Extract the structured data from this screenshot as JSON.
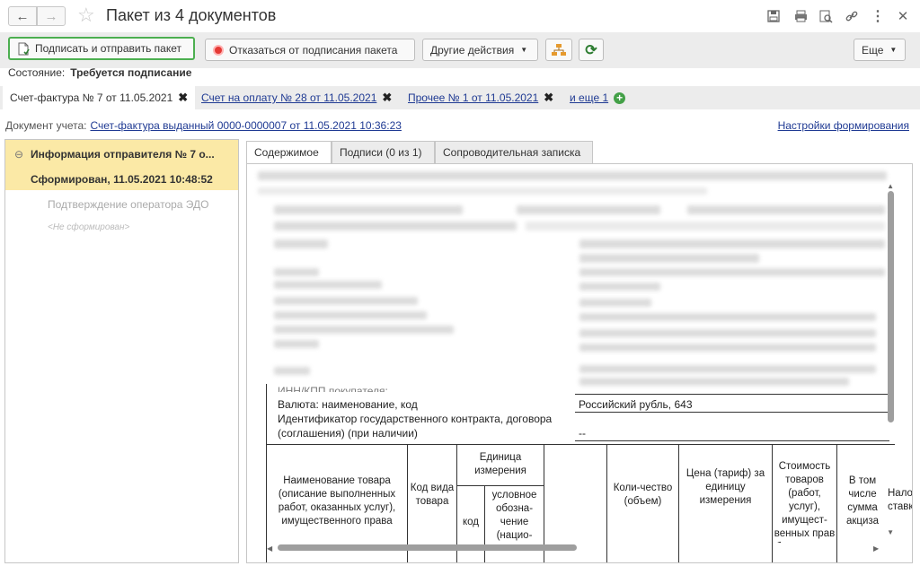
{
  "window": {
    "title": "Пакет из 4 документов",
    "back_icon": "arrow-left-icon",
    "forward_icon": "arrow-right-icon",
    "favorite_icon": "star-icon",
    "more_icon": "⋮"
  },
  "toolbar": {
    "sign_send": "Подписать и отправить пакет",
    "decline": "Отказаться от подписания пакета",
    "other_actions": "Другие действия",
    "more": "Еще"
  },
  "status": {
    "label": "Состояние:",
    "value": "Требуется подписание"
  },
  "doc_tabs": [
    {
      "label": "Счет-фактура № 7 от 11.05.2021"
    },
    {
      "label": "Счет на оплату № 28 от 11.05.2021"
    },
    {
      "label": "Прочее № 1 от 11.05.2021"
    },
    {
      "label": "и еще 1"
    }
  ],
  "account_doc": {
    "label": "Документ учета:",
    "link": "Счет-фактура выданный 0000-0000007 от 11.05.2021 10:36:23"
  },
  "settings_link": "Настройки формирования",
  "tree": {
    "item1_title": "Информация отправителя № 7 о...",
    "item1_status": "Сформирован, 11.05.2021 10:48:52",
    "item2_title": "Подтверждение оператора ЭДО",
    "item2_status": "<Не сформирован>"
  },
  "panel_tabs": [
    "Содержимое",
    "Подписи (0 из 1)",
    "Сопроводительная записка"
  ],
  "doc": {
    "partial_line": "ИНН/КПП покупателя:",
    "currency_label": "Валюта: наименование, код",
    "currency_value": "Российский рубль, 643",
    "contract_label_1": "Идентификатор государственного контракта, договора",
    "contract_label_2": "(соглашения) (при наличии)",
    "contract_value": "--",
    "table_headers": {
      "name": "Наименование товара (описание выполненных работ, оказанных услуг), имущественного права",
      "kind_code": "Код вида товара",
      "unit": "Единица измерения",
      "unit_code": "код",
      "unit_symbol": "условное обозна-чение (нацио-",
      "quantity": "Коли-чество (объем)",
      "price": "Цена (тариф) за единицу измерения",
      "cost": "Стоимость товаров (работ, услуг), имущест-венных прав без налога - всего",
      "excise": "В том числе сумма акциза",
      "tax_rate": "Налоговая ставка"
    }
  }
}
